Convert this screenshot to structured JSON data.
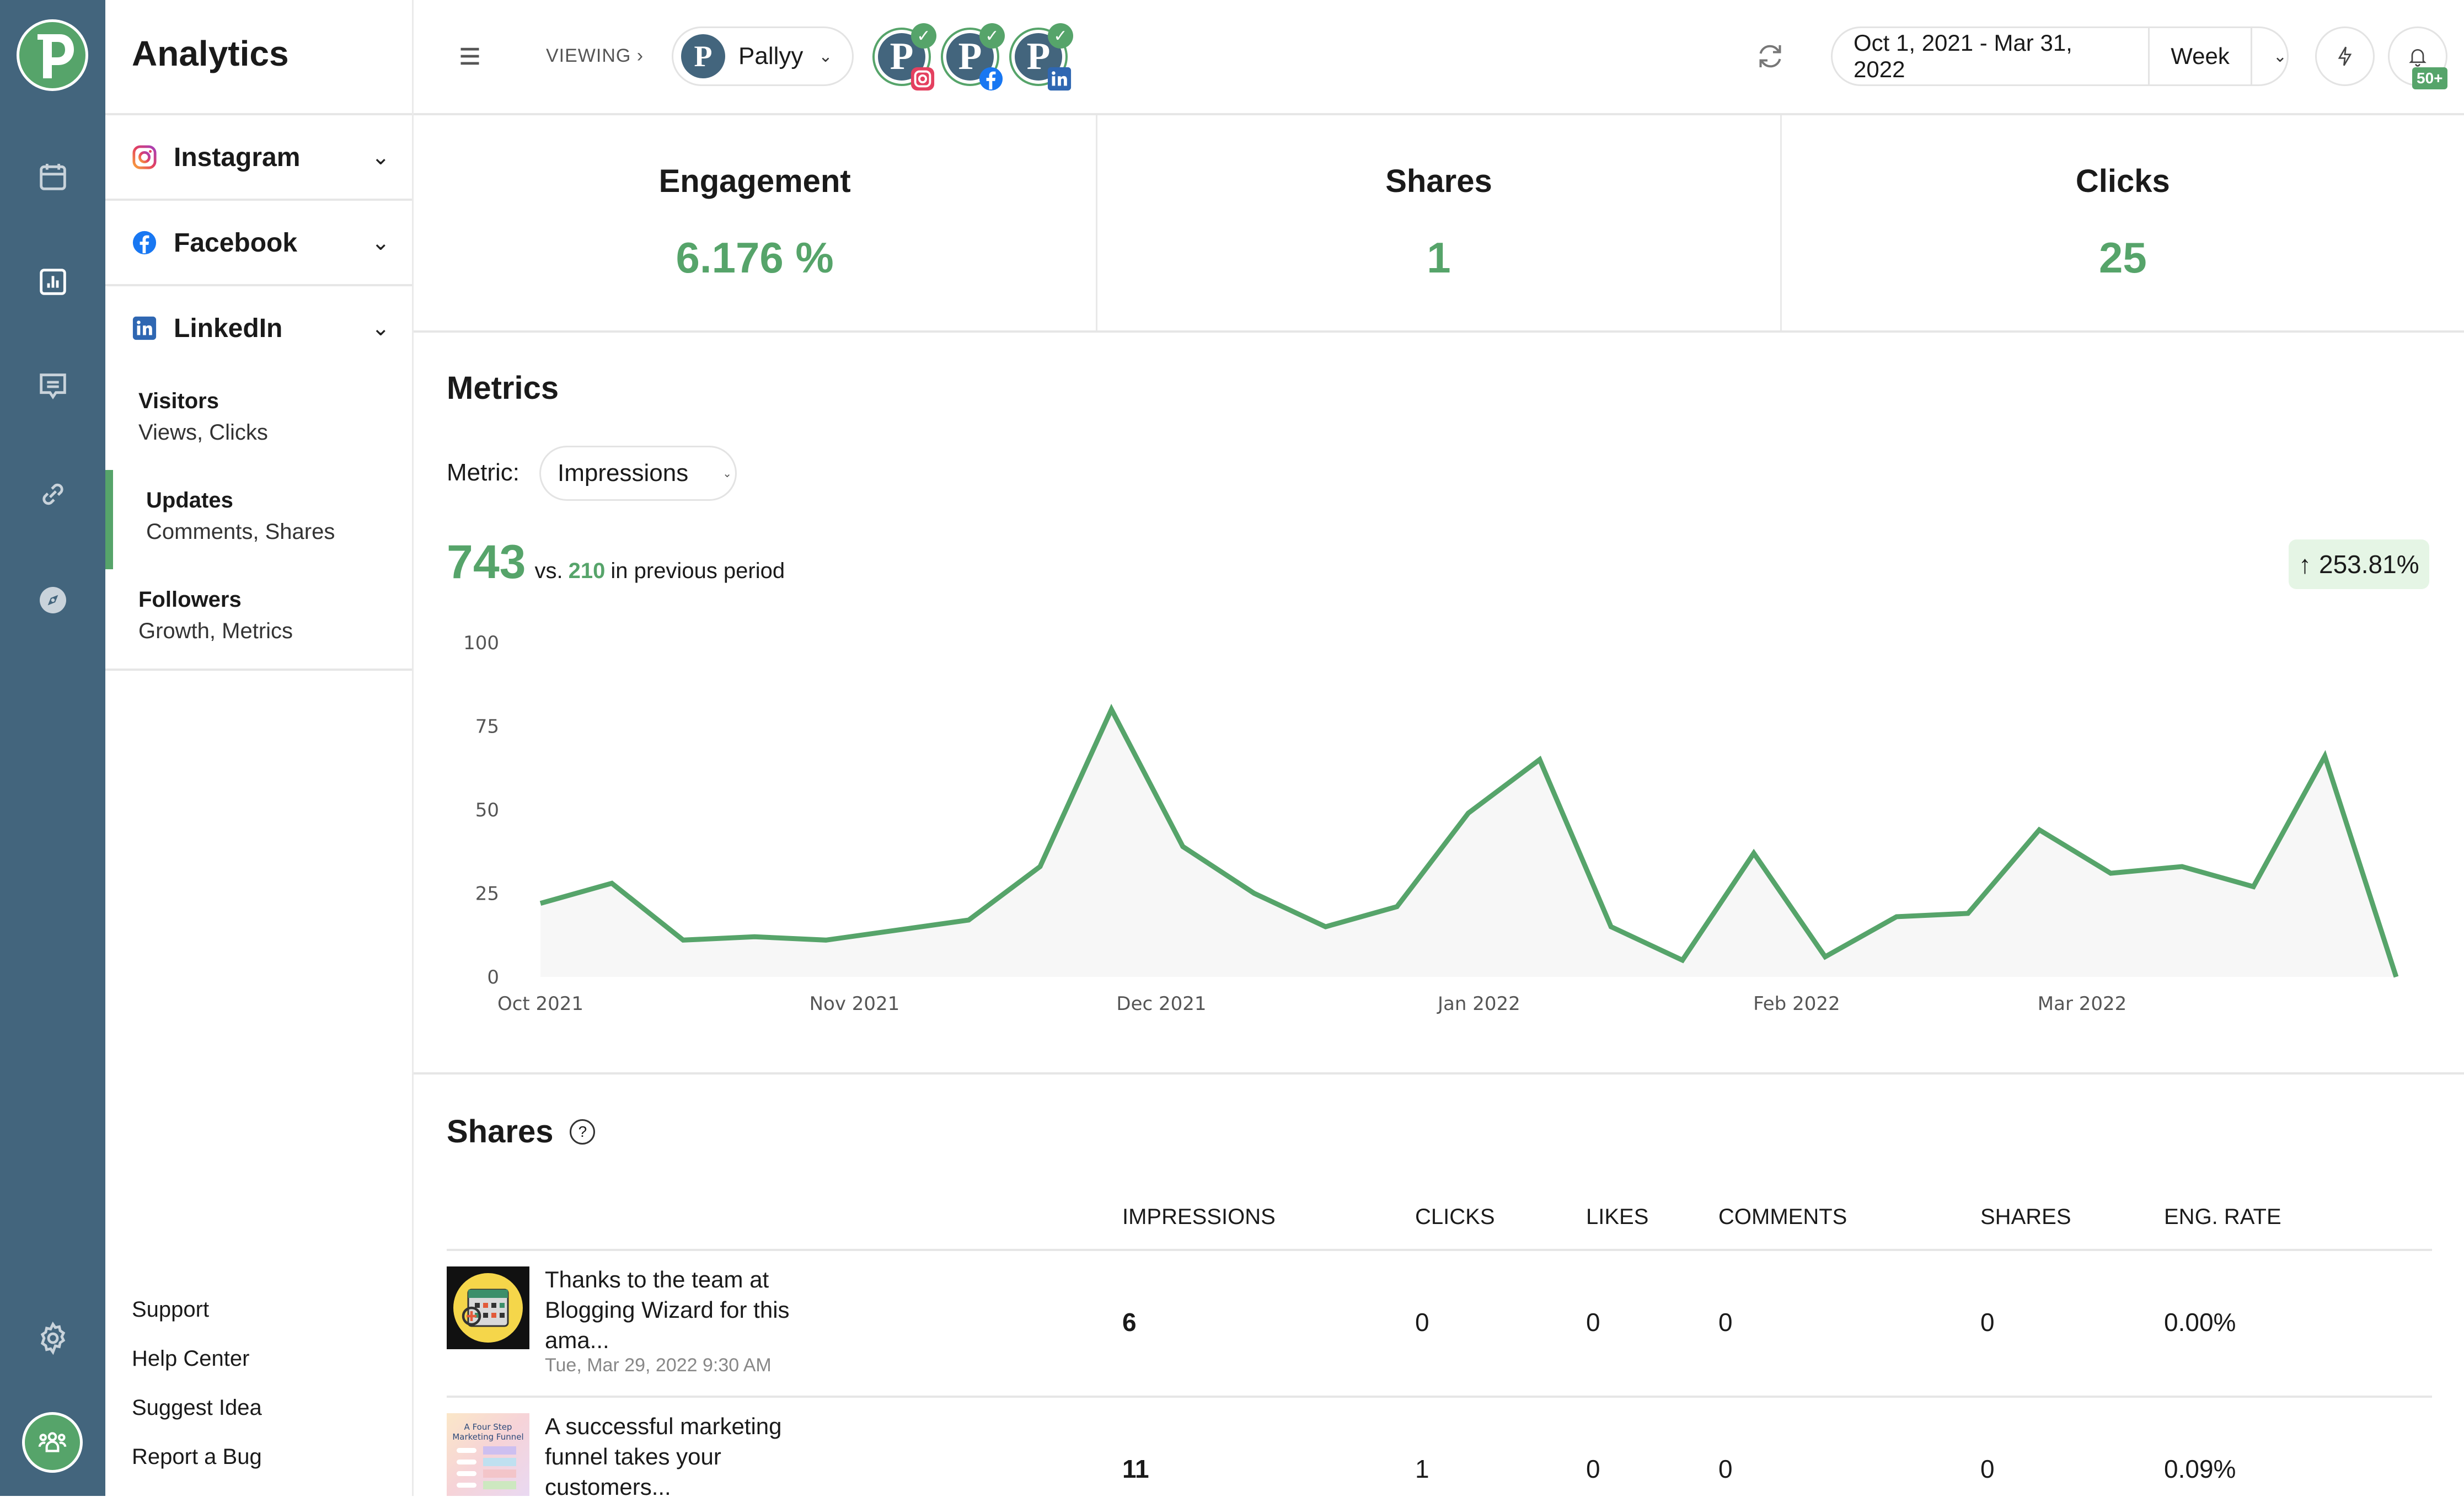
{
  "app": {
    "title": "Analytics"
  },
  "rail": {
    "items": [
      {
        "icon": "calendar-icon"
      },
      {
        "icon": "analytics-icon"
      },
      {
        "icon": "inbox-icon"
      },
      {
        "icon": "link-icon"
      },
      {
        "icon": "compass-icon"
      }
    ],
    "bottom": [
      {
        "icon": "gear-icon"
      },
      {
        "icon": "team-icon"
      }
    ]
  },
  "sidebar": {
    "networks": [
      {
        "label": "Instagram",
        "icon": "instagram-icon"
      },
      {
        "label": "Facebook",
        "icon": "facebook-icon"
      },
      {
        "label": "LinkedIn",
        "icon": "linkedin-icon"
      }
    ],
    "linkedin_items": [
      {
        "title": "Visitors",
        "subtitle": "Views, Clicks",
        "active": false
      },
      {
        "title": "Updates",
        "subtitle": "Comments, Shares",
        "active": true
      },
      {
        "title": "Followers",
        "subtitle": "Growth, Metrics",
        "active": false
      }
    ],
    "footer_links": [
      "Support",
      "Help Center",
      "Suggest Idea",
      "Report a Bug"
    ]
  },
  "header": {
    "viewing_label": "VIEWING ›",
    "account": {
      "initial": "P",
      "name": "Pallyy"
    },
    "profiles": [
      {
        "initial": "P",
        "network": "instagram",
        "connected": true
      },
      {
        "initial": "P",
        "network": "facebook",
        "connected": true
      },
      {
        "initial": "P",
        "network": "linkedin",
        "connected": true
      }
    ],
    "date_range": "Oct 1, 2021 - Mar 31, 2022",
    "granularity": "Week",
    "notifications_badge": "50+"
  },
  "stats": [
    {
      "title": "Engagement",
      "value": "6.176 %"
    },
    {
      "title": "Shares",
      "value": "1"
    },
    {
      "title": "Clicks",
      "value": "25"
    }
  ],
  "metrics": {
    "title": "Metrics",
    "metric_label": "Metric:",
    "metric_selected": "Impressions",
    "total": "743",
    "vs_label": "vs.",
    "previous": "210",
    "previous_suffix": "in previous period",
    "change": "253.81%",
    "change_direction": "up"
  },
  "chart_data": {
    "type": "area",
    "title": "",
    "xlabel": "",
    "ylabel": "Impressions",
    "ylim": [
      0,
      100
    ],
    "yticks": [
      0,
      25,
      50,
      75,
      100
    ],
    "xtick_labels": [
      "Oct 2021",
      "Nov 2021",
      "Dec 2021",
      "Jan 2022",
      "Feb 2022",
      "Mar 2022"
    ],
    "xtick_index": [
      0,
      4.4,
      8.7,
      13.15,
      17.6,
      21.6
    ],
    "grid": false,
    "legend": "none",
    "color": "#56a46a",
    "series": [
      {
        "name": "Impressions",
        "values": [
          22,
          28,
          11,
          12,
          11,
          14,
          17,
          33,
          80,
          39,
          25,
          15,
          21,
          49,
          65,
          15,
          5,
          37,
          6,
          18,
          19,
          44,
          31,
          33,
          27,
          66,
          0
        ]
      }
    ]
  },
  "shares_section": {
    "title": "Shares",
    "columns": [
      "IMPRESSIONS",
      "CLICKS",
      "LIKES",
      "COMMENTS",
      "SHARES",
      "ENG. RATE"
    ],
    "rows": [
      {
        "text": "Thanks to the team at Blogging Wizard for this ama...",
        "date": "Tue, Mar 29, 2022 9:30 AM",
        "impressions": "6",
        "clicks": "0",
        "likes": "0",
        "comments": "0",
        "shares": "0",
        "eng_rate": "0.00%"
      },
      {
        "text": "A successful marketing funnel takes your customers...",
        "date": "",
        "impressions": "11",
        "clicks": "1",
        "likes": "0",
        "comments": "0",
        "shares": "0",
        "eng_rate": "0.09%"
      }
    ]
  }
}
